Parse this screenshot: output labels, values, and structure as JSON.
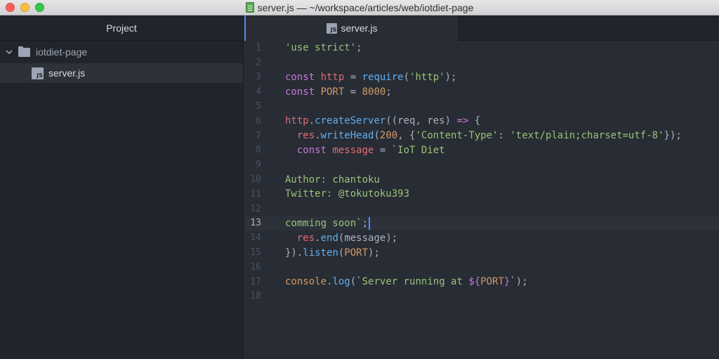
{
  "window": {
    "title": "server.js — ~/workspace/articles/web/iotdiet-page"
  },
  "sidebar": {
    "header": "Project",
    "root_folder": "iotdiet-page",
    "files": [
      {
        "name": "server.js",
        "icon": "JS"
      }
    ]
  },
  "tabs": [
    {
      "label": "server.js",
      "icon": "JS",
      "active": true
    }
  ],
  "editor": {
    "active_line": 13,
    "lines": [
      {
        "num": "1",
        "tokens": [
          {
            "t": "'use strict'",
            "c": "str"
          },
          {
            "t": ";",
            "c": "plain"
          }
        ]
      },
      {
        "num": "2",
        "tokens": []
      },
      {
        "num": "3",
        "tokens": [
          {
            "t": "const ",
            "c": "kw"
          },
          {
            "t": "http",
            "c": "var"
          },
          {
            "t": " = ",
            "c": "plain"
          },
          {
            "t": "require",
            "c": "fn"
          },
          {
            "t": "(",
            "c": "plain"
          },
          {
            "t": "'http'",
            "c": "str"
          },
          {
            "t": ");",
            "c": "plain"
          }
        ]
      },
      {
        "num": "4",
        "tokens": [
          {
            "t": "const ",
            "c": "kw"
          },
          {
            "t": "PORT",
            "c": "num"
          },
          {
            "t": " = ",
            "c": "plain"
          },
          {
            "t": "8000",
            "c": "num"
          },
          {
            "t": ";",
            "c": "plain"
          }
        ]
      },
      {
        "num": "5",
        "tokens": []
      },
      {
        "num": "6",
        "tokens": [
          {
            "t": "http",
            "c": "var"
          },
          {
            "t": ".",
            "c": "plain"
          },
          {
            "t": "createServer",
            "c": "fn"
          },
          {
            "t": "((req, res) ",
            "c": "plain"
          },
          {
            "t": "=>",
            "c": "kw"
          },
          {
            "t": " {",
            "c": "plain"
          }
        ]
      },
      {
        "num": "7",
        "tokens": [
          {
            "t": "  res",
            "c": "var"
          },
          {
            "t": ".",
            "c": "plain"
          },
          {
            "t": "writeHead",
            "c": "fn"
          },
          {
            "t": "(",
            "c": "plain"
          },
          {
            "t": "200",
            "c": "num"
          },
          {
            "t": ", {",
            "c": "plain"
          },
          {
            "t": "'Content-Type'",
            "c": "str"
          },
          {
            "t": ": ",
            "c": "plain"
          },
          {
            "t": "'text/plain;charset=utf-8'",
            "c": "str"
          },
          {
            "t": "});",
            "c": "plain"
          }
        ]
      },
      {
        "num": "8",
        "tokens": [
          {
            "t": "  const ",
            "c": "kw"
          },
          {
            "t": "message",
            "c": "var"
          },
          {
            "t": " = ",
            "c": "plain"
          },
          {
            "t": "`IoT Diet",
            "c": "str"
          }
        ]
      },
      {
        "num": "9",
        "tokens": []
      },
      {
        "num": "10",
        "tokens": [
          {
            "t": "Author: chantoku",
            "c": "str"
          }
        ]
      },
      {
        "num": "11",
        "tokens": [
          {
            "t": "Twitter: @tokutoku393",
            "c": "str"
          }
        ]
      },
      {
        "num": "12",
        "tokens": []
      },
      {
        "num": "13",
        "tokens": [
          {
            "t": "comming soon`",
            "c": "str"
          },
          {
            "t": ";",
            "c": "plain"
          }
        ]
      },
      {
        "num": "14",
        "tokens": [
          {
            "t": "  res",
            "c": "var"
          },
          {
            "t": ".",
            "c": "plain"
          },
          {
            "t": "end",
            "c": "fn"
          },
          {
            "t": "(message);",
            "c": "plain"
          }
        ]
      },
      {
        "num": "15",
        "tokens": [
          {
            "t": "}).",
            "c": "plain"
          },
          {
            "t": "listen",
            "c": "fn"
          },
          {
            "t": "(",
            "c": "plain"
          },
          {
            "t": "PORT",
            "c": "num"
          },
          {
            "t": ");",
            "c": "plain"
          }
        ]
      },
      {
        "num": "16",
        "tokens": []
      },
      {
        "num": "17",
        "tokens": [
          {
            "t": "console",
            "c": "num"
          },
          {
            "t": ".",
            "c": "plain"
          },
          {
            "t": "log",
            "c": "fn"
          },
          {
            "t": "(",
            "c": "plain"
          },
          {
            "t": "`Server running at ",
            "c": "str"
          },
          {
            "t": "${",
            "c": "kw"
          },
          {
            "t": "PORT",
            "c": "num"
          },
          {
            "t": "}",
            "c": "kw"
          },
          {
            "t": "`",
            "c": "str"
          },
          {
            "t": ");",
            "c": "plain"
          }
        ]
      },
      {
        "num": "18",
        "tokens": []
      }
    ]
  },
  "colors": {
    "keyword": "#c678dd",
    "string": "#98c379",
    "number": "#d19a66",
    "variable": "#e06c75",
    "function": "#61afef",
    "cursor": "#528bff"
  }
}
